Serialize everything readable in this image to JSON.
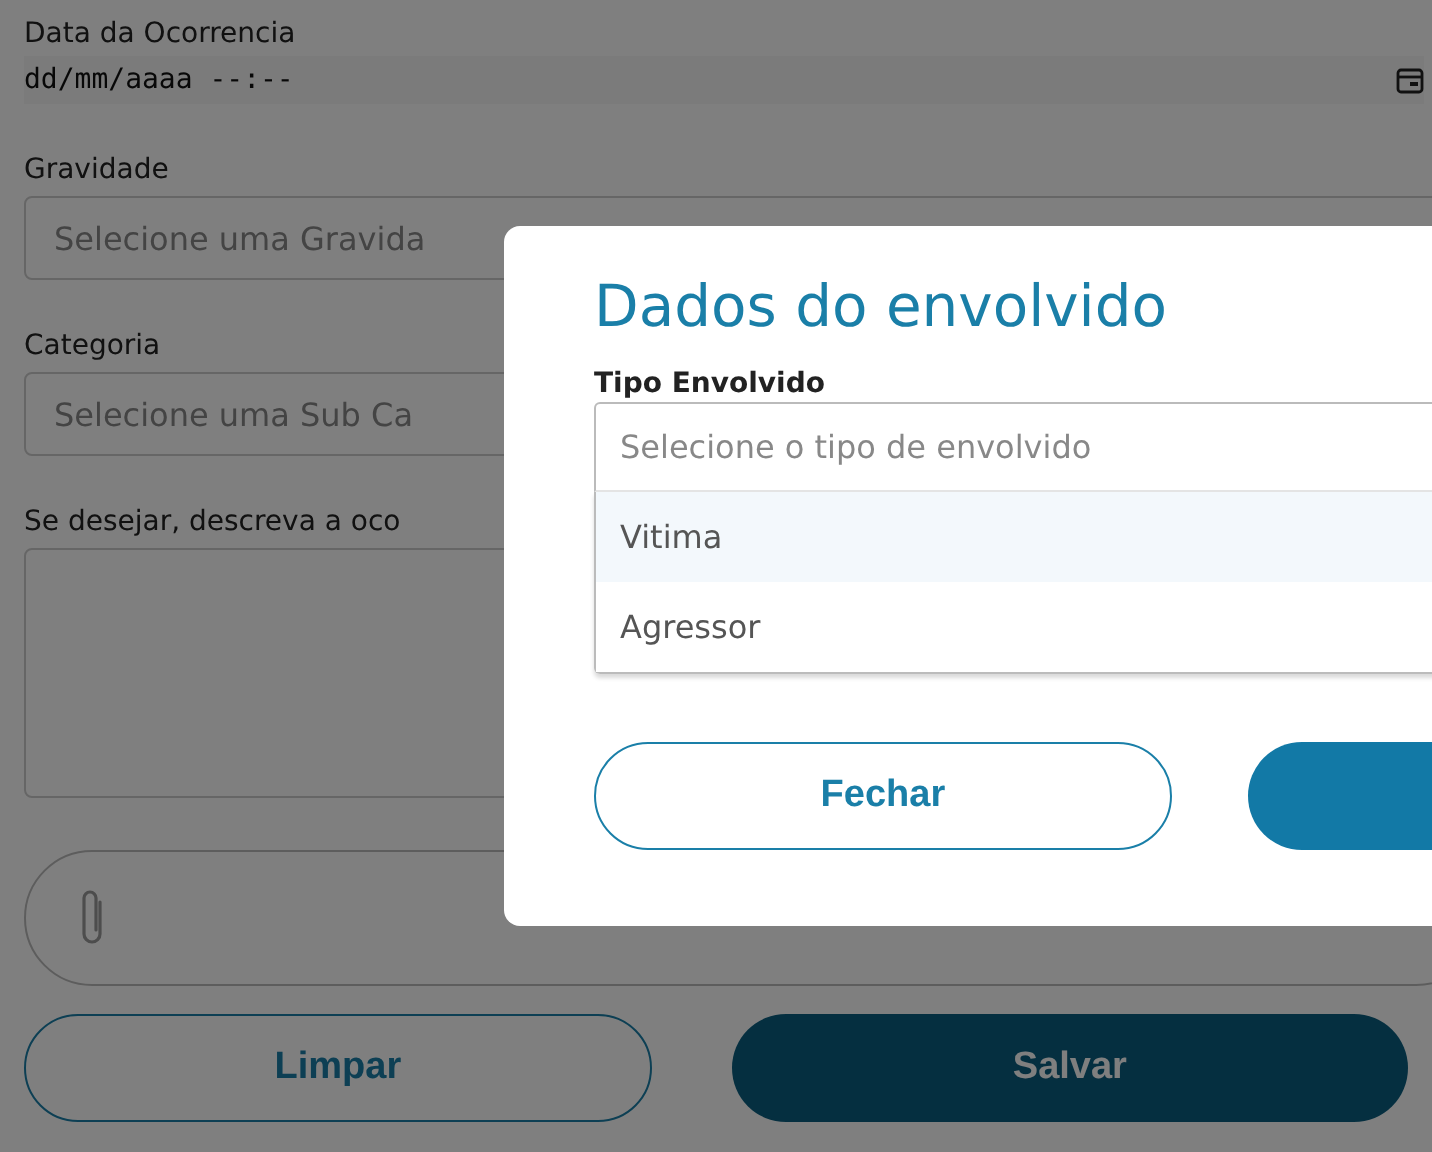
{
  "form": {
    "date": {
      "label": "Data da Ocorrencia",
      "value": "dd/mm/aaaa --:--"
    },
    "severity": {
      "label": "Gravidade",
      "placeholder": "Selecione uma Gravida"
    },
    "category": {
      "label": "Categoria",
      "placeholder": "Selecione uma Sub Ca"
    },
    "description": {
      "label": "Se desejar, descreva a oco"
    },
    "buttons": [
      {
        "label": "Limpar",
        "kind": "outline"
      },
      {
        "label": "Salvar",
        "kind": "solid"
      }
    ]
  },
  "modal": {
    "title": "Dados do envolvido",
    "field_label": "Tipo Envolvido",
    "placeholder": "Selecione o tipo de envolvido",
    "options": [
      {
        "label": "Vitima",
        "selected": true
      },
      {
        "label": "Agressor",
        "selected": false
      }
    ],
    "buttons": [
      {
        "label": "Fechar",
        "kind": "outline"
      },
      {
        "kind": "solid"
      }
    ]
  }
}
